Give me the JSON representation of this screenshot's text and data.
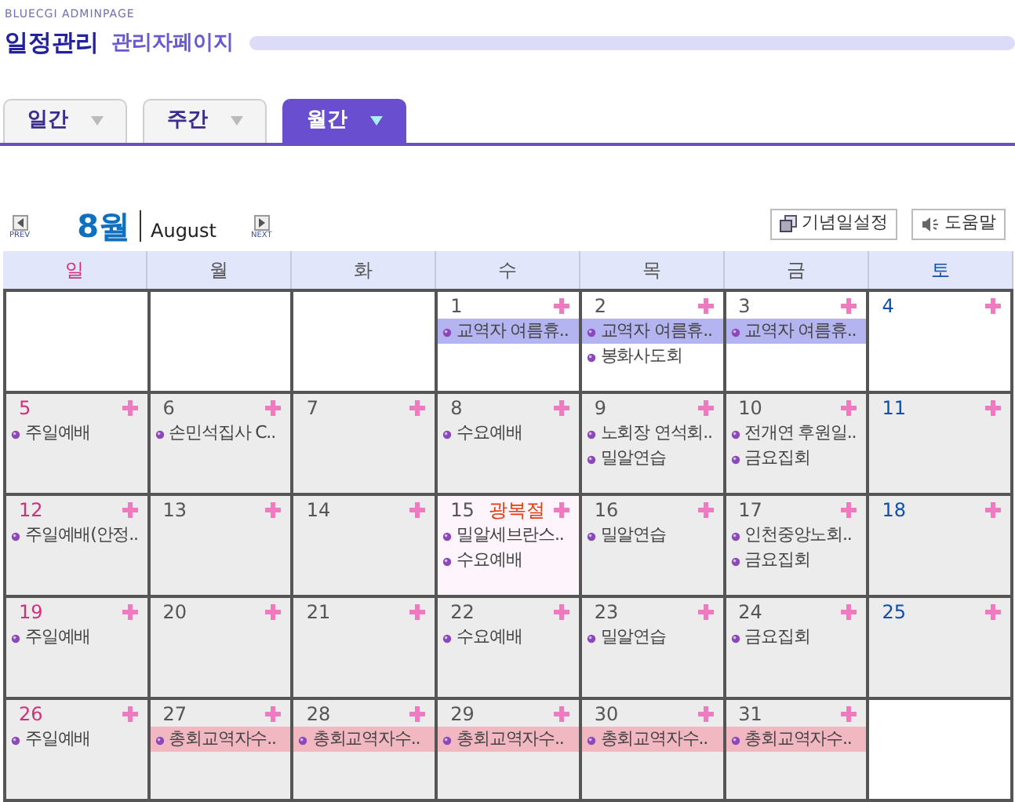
{
  "header": {
    "brand": "BLUECGI ADMINPAGE",
    "title": "일정관리",
    "subtitle": "관리자페이지"
  },
  "tabs": [
    {
      "label": "일간",
      "selected": false
    },
    {
      "label": "주간",
      "selected": false
    },
    {
      "label": "월간",
      "selected": true
    }
  ],
  "month_nav": {
    "prev": "PREV",
    "month": "8월",
    "month_en": "August",
    "next": "NEXT"
  },
  "buttons": [
    {
      "label": "기념일설정",
      "kind": "anniversary"
    },
    {
      "label": "도움말",
      "kind": "help"
    }
  ],
  "calendar": {
    "weekdays": [
      "일",
      "월",
      "화",
      "수",
      "목",
      "금",
      "토"
    ],
    "weeks": [
      {
        "shaded": false,
        "days": [
          {
            "kind": "empty"
          },
          {
            "kind": "empty"
          },
          {
            "kind": "empty"
          },
          {
            "kind": "day",
            "day": "1",
            "events": [
              {
                "text": "교역자 여름휴..",
                "color": "#b4b4f0"
              }
            ]
          },
          {
            "kind": "day",
            "day": "2",
            "events": [
              {
                "text": "교역자 여름휴..",
                "color": "#b4b4f0"
              },
              {
                "text": "봉화사도회"
              }
            ]
          },
          {
            "kind": "day",
            "day": "3",
            "events": [
              {
                "text": "교역자 여름휴..",
                "color": "#b4b4f0"
              }
            ]
          },
          {
            "kind": "day",
            "day": "4"
          }
        ]
      },
      {
        "shaded": true,
        "days": [
          {
            "kind": "day",
            "day": "5",
            "events": [
              {
                "text": "주일예배"
              }
            ]
          },
          {
            "kind": "day",
            "day": "6",
            "events": [
              {
                "text": "손민석집사 C.."
              }
            ]
          },
          {
            "kind": "day",
            "day": "7"
          },
          {
            "kind": "day",
            "day": "8",
            "events": [
              {
                "text": "수요예배"
              }
            ]
          },
          {
            "kind": "day",
            "day": "9",
            "events": [
              {
                "text": "노회장 연석회.."
              },
              {
                "text": "밀알연습"
              }
            ]
          },
          {
            "kind": "day",
            "day": "10",
            "events": [
              {
                "text": "전개연 후원일.."
              },
              {
                "text": "금요집회"
              }
            ]
          },
          {
            "kind": "day",
            "day": "11"
          }
        ]
      },
      {
        "shaded": true,
        "days": [
          {
            "kind": "day",
            "day": "12",
            "events": [
              {
                "text": "주일예배(안정.."
              }
            ]
          },
          {
            "kind": "day",
            "day": "13"
          },
          {
            "kind": "day",
            "day": "14"
          },
          {
            "kind": "day",
            "day": "15",
            "holiday": "광복절",
            "events": [
              {
                "text": "밀알세브란스.."
              },
              {
                "text": "수요예배"
              }
            ]
          },
          {
            "kind": "day",
            "day": "16",
            "events": [
              {
                "text": "밀알연습"
              }
            ]
          },
          {
            "kind": "day",
            "day": "17",
            "events": [
              {
                "text": "인천중앙노회.."
              },
              {
                "text": "금요집회"
              }
            ]
          },
          {
            "kind": "day",
            "day": "18"
          }
        ]
      },
      {
        "shaded": true,
        "days": [
          {
            "kind": "day",
            "day": "19",
            "events": [
              {
                "text": "주일예배"
              }
            ]
          },
          {
            "kind": "day",
            "day": "20"
          },
          {
            "kind": "day",
            "day": "21"
          },
          {
            "kind": "day",
            "day": "22",
            "events": [
              {
                "text": "수요예배"
              }
            ]
          },
          {
            "kind": "day",
            "day": "23",
            "events": [
              {
                "text": "밀알연습"
              }
            ]
          },
          {
            "kind": "day",
            "day": "24",
            "events": [
              {
                "text": "금요집회"
              }
            ]
          },
          {
            "kind": "day",
            "day": "25"
          }
        ]
      },
      {
        "shaded": true,
        "days": [
          {
            "kind": "day",
            "day": "26",
            "events": [
              {
                "text": "주일예배"
              }
            ]
          },
          {
            "kind": "day",
            "day": "27",
            "events": [
              {
                "text": "총회교역자수..",
                "color": "#f2b8c2"
              }
            ]
          },
          {
            "kind": "day",
            "day": "28",
            "events": [
              {
                "text": "총회교역자수..",
                "color": "#f2b8c2"
              }
            ]
          },
          {
            "kind": "day",
            "day": "29",
            "events": [
              {
                "text": "총회교역자수..",
                "color": "#f2b8c2"
              }
            ]
          },
          {
            "kind": "day",
            "day": "30",
            "events": [
              {
                "text": "총회교역자수..",
                "color": "#f2b8c2"
              }
            ]
          },
          {
            "kind": "day",
            "day": "31",
            "events": [
              {
                "text": "총회교역자수..",
                "color": "#f2b8c2"
              }
            ]
          },
          {
            "kind": "empty"
          }
        ]
      }
    ]
  }
}
